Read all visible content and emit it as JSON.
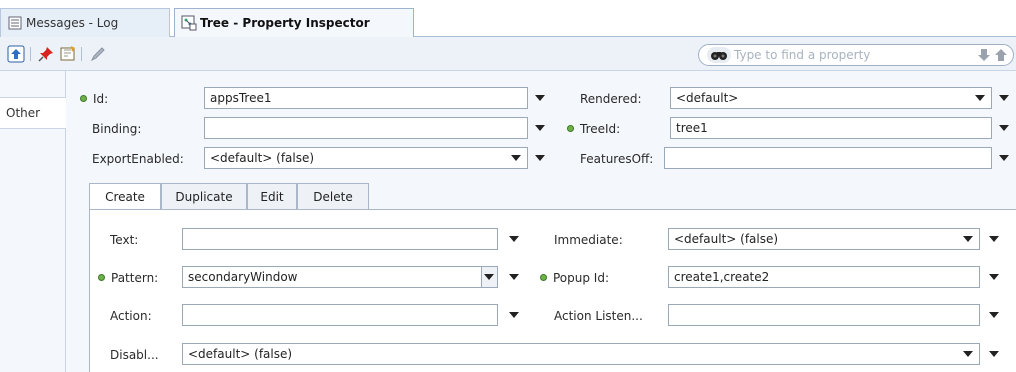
{
  "tabs": [
    {
      "label": "Messages - Log",
      "icon": "log-icon"
    },
    {
      "label": "Tree - Property Inspector",
      "icon": "tree-inspector-icon"
    }
  ],
  "toolbar": {
    "buttons": [
      "upload-icon",
      "pin-icon",
      "edit-properties-icon",
      "pencil-icon"
    ],
    "search_placeholder": "Type to find a property"
  },
  "sidebar": {
    "category": "Other"
  },
  "properties": {
    "id": {
      "label": "Id:",
      "value": "appsTree1"
    },
    "rendered": {
      "label": "Rendered:",
      "value": "<default>"
    },
    "binding": {
      "label": "Binding:",
      "value": ""
    },
    "tree_id": {
      "label": "TreeId:",
      "value": "tree1"
    },
    "export_enabled": {
      "label": "ExportEnabled:",
      "value": "<default> (false)"
    },
    "features_off": {
      "label": "FeaturesOff:",
      "value": ""
    }
  },
  "inner_tabs": [
    "Create",
    "Duplicate",
    "Edit",
    "Delete"
  ],
  "create": {
    "text": {
      "label": "Text:",
      "value": ""
    },
    "immediate": {
      "label": "Immediate:",
      "value": "<default> (false)"
    },
    "pattern": {
      "label": "Pattern:",
      "value": "secondaryWindow"
    },
    "popup_id": {
      "label": "Popup Id:",
      "value": "create1,create2"
    },
    "action": {
      "label": "Action:",
      "value": ""
    },
    "action_listener": {
      "label": "Action Listen...",
      "value": ""
    },
    "disabled": {
      "label": "Disabl...",
      "value": "<default> (false)"
    }
  },
  "colors": {
    "required_dot": "#6fb04a",
    "tab_border": "#9db3cf",
    "panel_bg": "#f4f7fb"
  }
}
